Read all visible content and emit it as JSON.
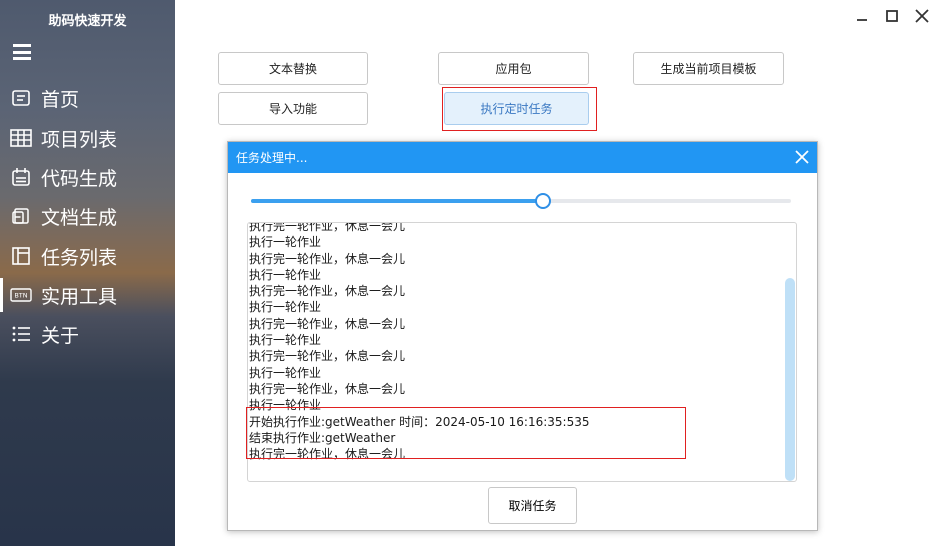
{
  "app": {
    "title": "助码快速开发"
  },
  "sidebar": {
    "items": [
      {
        "label": "首页",
        "icon": "home-icon"
      },
      {
        "label": "项目列表",
        "icon": "table-icon"
      },
      {
        "label": "代码生成",
        "icon": "calendar-icon"
      },
      {
        "label": "文档生成",
        "icon": "document-icon"
      },
      {
        "label": "任务列表",
        "icon": "layout-icon"
      },
      {
        "label": "实用工具",
        "icon": "btn-icon"
      },
      {
        "label": "关于",
        "icon": "list-icon"
      }
    ],
    "btn_icon_text": "BTN"
  },
  "toolbar": {
    "text_replace": "文本替换",
    "app_package": "应用包",
    "gen_template": "生成当前项目模板",
    "import_feature": "导入功能",
    "run_scheduled": "执行定时任务"
  },
  "dialog": {
    "title": "任务处理中...",
    "progress": 0.5,
    "log_lines": [
      "执行完一轮作业，休息一会儿",
      "执行一轮作业",
      "执行完一轮作业，休息一会儿",
      "执行一轮作业",
      "执行完一轮作业，休息一会儿",
      "执行一轮作业",
      "执行完一轮作业，休息一会儿",
      "执行一轮作业",
      "执行完一轮作业，休息一会儿",
      "执行一轮作业",
      "执行完一轮作业，休息一会儿",
      "执行一轮作业",
      "开始执行作业:getWeather  时间：2024-05-10  16:16:35:535",
      "结束执行作业:getWeather",
      "执行完一轮作业，休息一会儿"
    ],
    "cancel_label": "取消任务"
  },
  "colors": {
    "accent": "#2196f3",
    "highlight_box": "#e02020"
  }
}
